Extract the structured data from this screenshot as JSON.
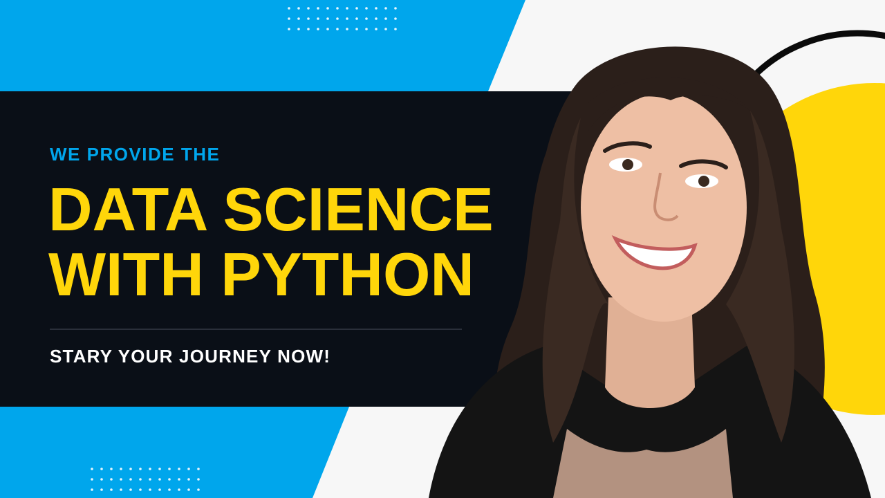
{
  "banner": {
    "kicker": "WE PROVIDE THE",
    "headline_line1": "DATA SCIENCE",
    "headline_line2": "WITH PYTHON",
    "subtext": "STARY YOUR JOURNEY NOW!"
  },
  "colors": {
    "blue": "#00a6ec",
    "dark_panel": "#0a0f17",
    "yellow": "#ffd60a",
    "white_text": "#ffffff",
    "light_bg": "#f7f7f7",
    "ring": "#0b0b0b"
  },
  "image": {
    "subject": "smiling woman with long brown wavy hair in black blazer"
  }
}
